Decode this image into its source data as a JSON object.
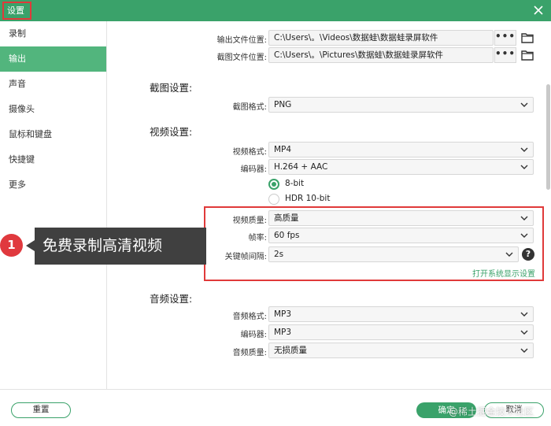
{
  "window": {
    "title": "设置"
  },
  "sidebar": {
    "items": [
      {
        "label": "录制"
      },
      {
        "label": "输出"
      },
      {
        "label": "声音"
      },
      {
        "label": "摄像头"
      },
      {
        "label": "鼠标和键盘"
      },
      {
        "label": "快捷键"
      },
      {
        "label": "更多"
      }
    ],
    "active": "输出"
  },
  "output": {
    "output_location_label": "输出文件位置:",
    "output_location_value": "C:\\Users\\。\\Videos\\数据蛙\\数据蛙录屏软件",
    "screenshot_location_label": "截图文件位置:",
    "screenshot_location_value": "C:\\Users\\。\\Pictures\\数据蛙\\数据蛙录屏软件",
    "browse_label": "•••"
  },
  "screenshot_settings": {
    "heading": "截图设置:",
    "format_label": "截图格式:",
    "format_value": "PNG"
  },
  "video_settings": {
    "heading": "视频设置:",
    "format_label": "视频格式:",
    "format_value": "MP4",
    "encoder_label": "编码器:",
    "encoder_value": "H.264 + AAC",
    "bitdepth_options": [
      "8-bit",
      "HDR 10-bit"
    ],
    "bitdepth_selected": "8-bit",
    "quality_label": "视频质量:",
    "quality_value": "高质量",
    "framerate_label": "帧率:",
    "framerate_value": "60 fps",
    "keyframe_label": "关键帧间隔:",
    "keyframe_value": "2s",
    "help_label": "?",
    "system_display_link": "打开系统显示设置"
  },
  "audio_settings": {
    "heading": "音频设置:",
    "format_label": "音频格式:",
    "format_value": "MP3",
    "encoder_label": "编码器:",
    "encoder_value": "MP3",
    "quality_label": "音频质量:",
    "quality_value": "无损质量"
  },
  "footer": {
    "reset_label": "重置",
    "ok_label": "确定",
    "cancel_label": "取消"
  },
  "annotation": {
    "badge_number": "1",
    "callout_text": "免费录制高清视频"
  },
  "watermark": "@稀土掘金技术社区",
  "colors": {
    "accent": "#3aa26a",
    "sidebar_active": "#52b57d",
    "highlight_border": "#e03a3a",
    "callout_bg": "#404040",
    "badge": "#e0393e"
  }
}
